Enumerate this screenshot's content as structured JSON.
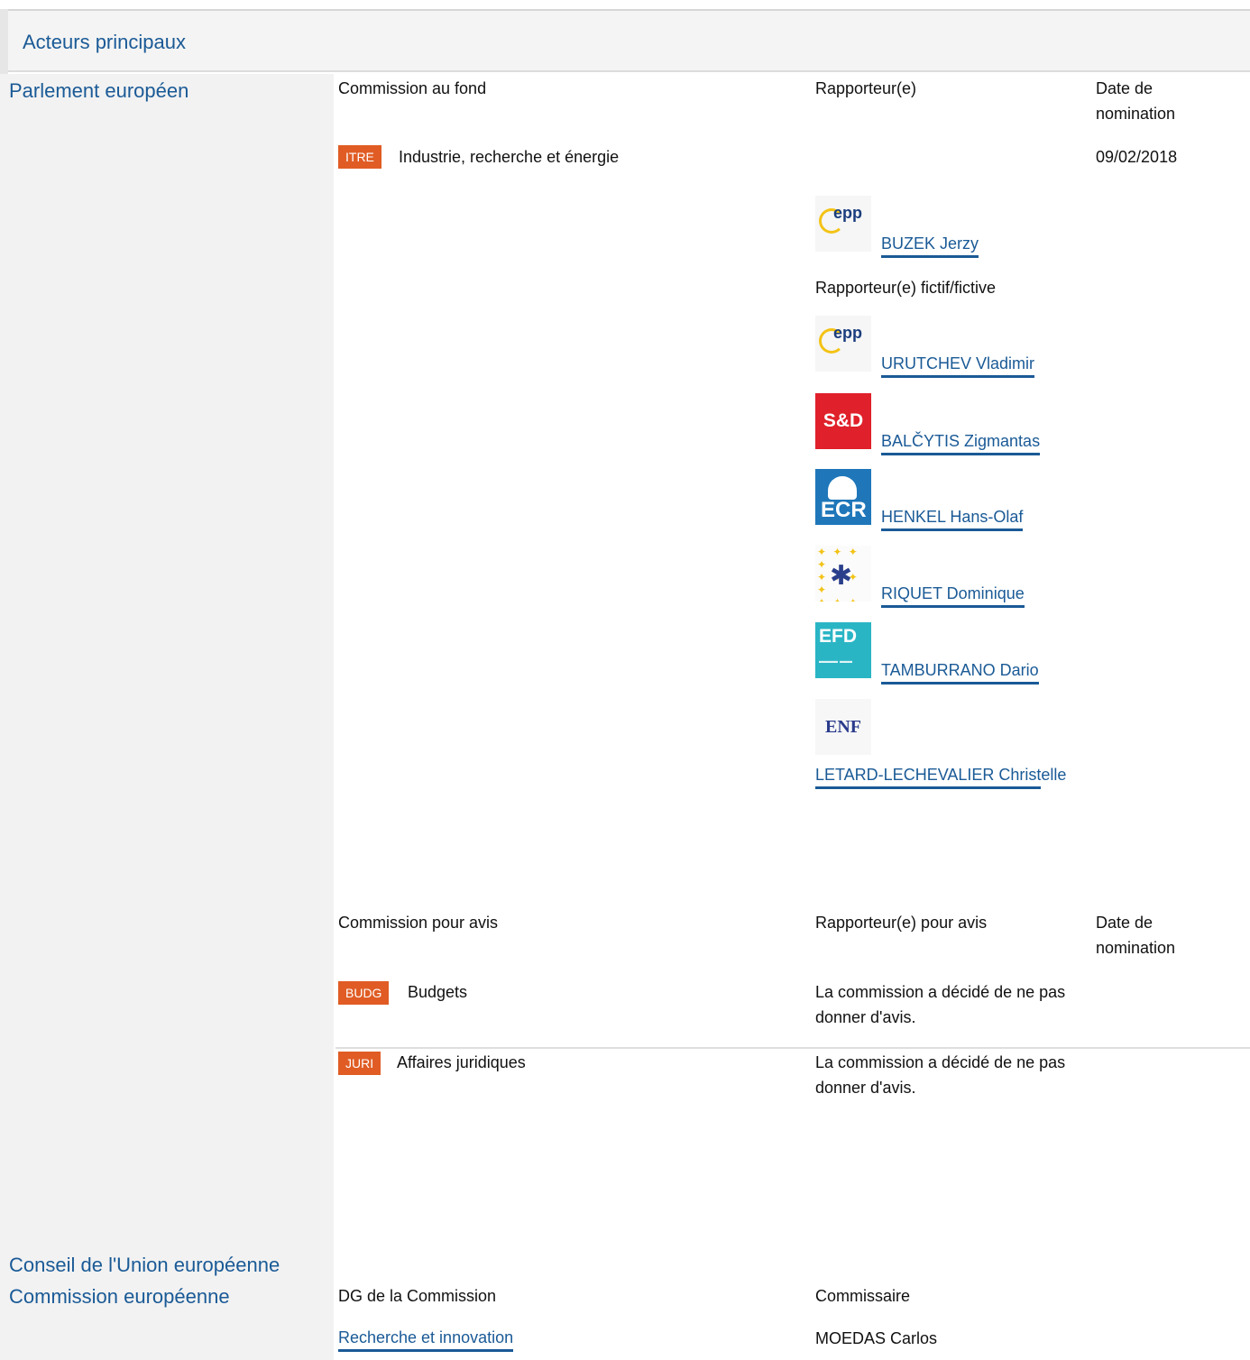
{
  "header": {
    "title": "Acteurs principaux"
  },
  "sections": {
    "parliament": "Parlement européen",
    "council": "Conseil de l'Union européenne",
    "commission": "Commission européenne"
  },
  "lead_committee": {
    "col_committee": "Commission au fond",
    "col_rapporteur": "Rapporteur(e)",
    "col_date": "Date de nomination",
    "badge": "ITRE",
    "name": "Industrie, recherche et énergie",
    "date": "09/02/2018",
    "rapporteur": {
      "name": "BUZEK Jerzy",
      "group_logo": "epp-logo"
    },
    "shadow_label": "Rapporteur(e) fictif/fictive",
    "shadows": [
      {
        "name": "URUTCHEV Vladimir",
        "group_logo": "epp-logo"
      },
      {
        "name": "BALČYTIS Zigmantas",
        "group_logo": "sd-logo",
        "logo_text": "S&D"
      },
      {
        "name": "HENKEL Hans-Olaf",
        "group_logo": "ecr-logo",
        "logo_text": "ECR"
      },
      {
        "name": "RIQUET Dominique",
        "group_logo": "renew-logo"
      },
      {
        "name": "TAMBURRANO Dario",
        "group_logo": "efd-logo",
        "logo_text": "EFD"
      },
      {
        "name": "LETARD-LECHEVALIER Christelle",
        "group_logo": "enf-logo",
        "logo_text": "ENF"
      }
    ]
  },
  "opinion_committees": {
    "col_committee": "Commission pour avis",
    "col_rapporteur": "Rapporteur(e) pour avis",
    "col_date": "Date de nomination",
    "rows": [
      {
        "badge": "BUDG",
        "name": "Budgets",
        "status": "La commission a décidé de ne pas donner d'avis."
      },
      {
        "badge": "JURI",
        "name": "Affaires juridiques",
        "status": "La commission a décidé de ne pas donner d'avis."
      }
    ]
  },
  "commission_block": {
    "col_dg": "DG de la Commission",
    "col_commissioner": "Commissaire",
    "dg": "Recherche et innovation",
    "commissioner": "MOEDAS Carlos"
  },
  "colors": {
    "accent_blue": "#1a5a96",
    "badge_orange": "#e05c24"
  }
}
